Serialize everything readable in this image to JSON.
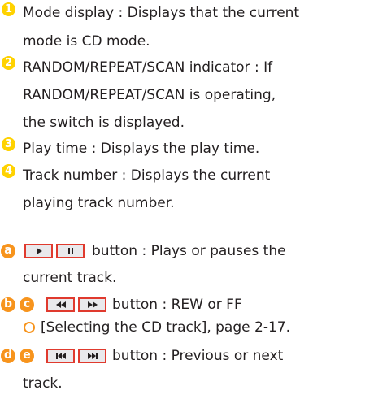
{
  "colors": {
    "number_badge": "#ffd200",
    "letter_badge": "#f7941d",
    "button_border": "#e03a2e",
    "text": "#231f20"
  },
  "items": [
    {
      "badge": "1",
      "lines": [
        "Mode display : Displays that the current",
        "mode is CD mode."
      ]
    },
    {
      "badge": "2",
      "lines": [
        "RANDOM/REPEAT/SCAN indicator : If",
        "RANDOM/REPEAT/SCAN is operating,",
        "the switch is displayed."
      ]
    },
    {
      "badge": "3",
      "lines": [
        "Play time : Displays the play time."
      ]
    },
    {
      "badge": "4",
      "lines": [
        "Track number : Displays the current",
        "playing track number."
      ]
    }
  ],
  "controls": [
    {
      "badges": [
        "a"
      ],
      "icons": [
        "play-icon",
        "pause-icon"
      ],
      "text": "button : Plays or pauses the",
      "continuation": "current track."
    },
    {
      "badges": [
        "b",
        "c"
      ],
      "icons": [
        "rewind-icon",
        "fast-forward-icon"
      ],
      "text": "button : REW or FF",
      "note": "[Selecting the CD track], page 2-17."
    },
    {
      "badges": [
        "d",
        "e"
      ],
      "icons": [
        "previous-track-icon",
        "next-track-icon"
      ],
      "text": "button : Previous or next",
      "continuation": "track."
    }
  ]
}
